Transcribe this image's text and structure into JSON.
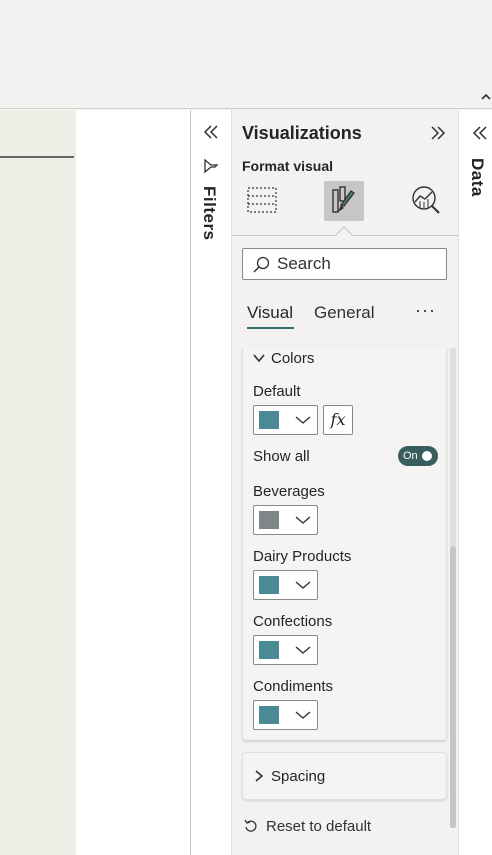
{
  "filters": {
    "label": "Filters"
  },
  "visualizations": {
    "title": "Visualizations",
    "format_visual": "Format visual",
    "icons": [
      "build-visual-icon",
      "format-visual-icon",
      "analytics-icon"
    ]
  },
  "search": {
    "placeholder": "Search",
    "value": ""
  },
  "tabs": {
    "visual": "Visual",
    "general": "General",
    "more": "···"
  },
  "colors_section": {
    "title": "Colors",
    "default_label": "Default",
    "fx_label": "fx",
    "show_all_label": "Show all",
    "toggle_state": "On",
    "items": [
      {
        "label": "Beverages",
        "color": "#7f8687"
      },
      {
        "label": "Dairy Products",
        "color": "#4a8a94"
      },
      {
        "label": "Confections",
        "color": "#4a8a94"
      },
      {
        "label": "Condiments",
        "color": "#4a8a94"
      }
    ],
    "default_color": "#4a8a94"
  },
  "spacing_section": {
    "title": "Spacing"
  },
  "reset": {
    "label": "Reset to default"
  },
  "data_pane": {
    "label": "Data"
  },
  "colors": {
    "accent": "#3a6e6e",
    "toggle_bg": "#3a5e5e",
    "pane_bg": "#f3f2f1"
  }
}
